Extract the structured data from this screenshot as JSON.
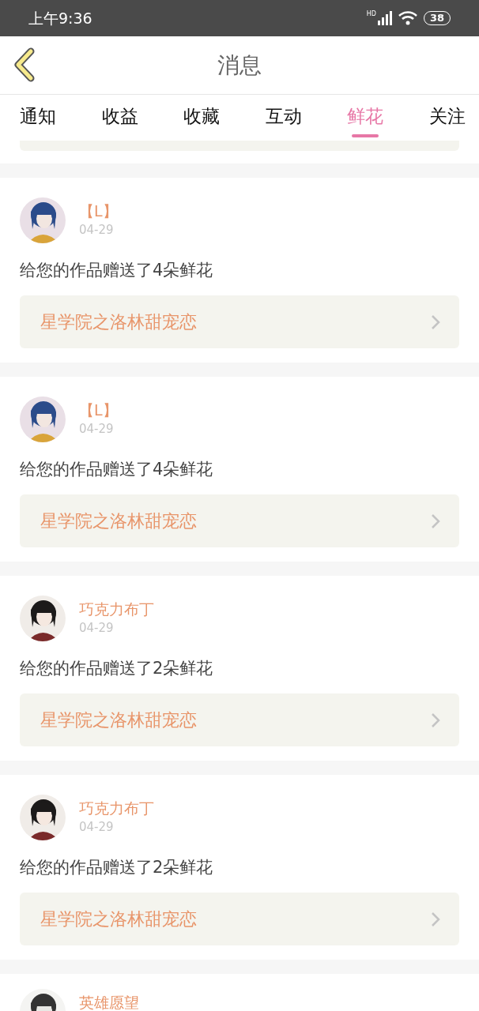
{
  "status_bar": {
    "time": "上午9:36",
    "network": "HD",
    "battery": "38"
  },
  "header": {
    "title": "消息"
  },
  "tabs": [
    {
      "label": "通知",
      "selected": false
    },
    {
      "label": "收益",
      "selected": false
    },
    {
      "label": "收藏",
      "selected": false
    },
    {
      "label": "互动",
      "selected": false
    },
    {
      "label": "鲜花",
      "selected": true
    },
    {
      "label": "关注",
      "selected": false
    }
  ],
  "messages": [
    {
      "kind": "partial_top"
    },
    {
      "kind": "full",
      "name": "【L】",
      "date": "04-29",
      "text": "给您的作品赠送了4朵鲜花",
      "book": "星学院之洛林甜宠恋"
    },
    {
      "kind": "full",
      "name": "【L】",
      "date": "04-29",
      "text": "给您的作品赠送了4朵鲜花",
      "book": "星学院之洛林甜宠恋"
    },
    {
      "kind": "full",
      "name": "巧克力布丁",
      "date": "04-29",
      "text": "给您的作品赠送了2朵鲜花",
      "book": "星学院之洛林甜宠恋"
    },
    {
      "kind": "full",
      "name": "巧克力布丁",
      "date": "04-29",
      "text": "给您的作品赠送了2朵鲜花",
      "book": "星学院之洛林甜宠恋"
    },
    {
      "kind": "partial_bottom",
      "name": "英雄愿望"
    }
  ]
}
